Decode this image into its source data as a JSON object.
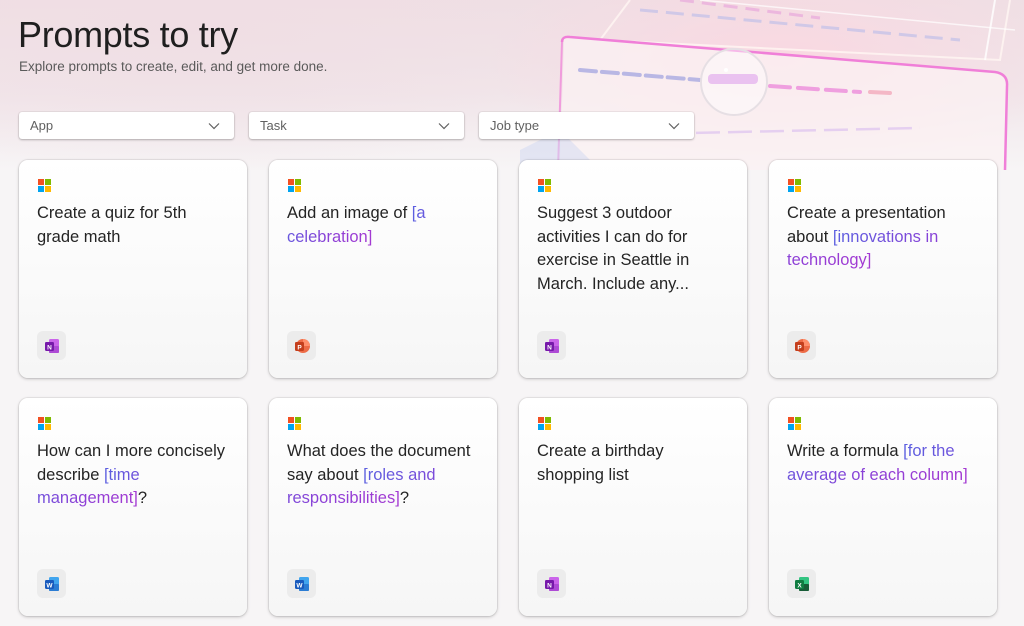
{
  "header": {
    "title": "Prompts to try",
    "subtitle": "Explore prompts to create, edit, and get more done."
  },
  "filters": [
    {
      "label": "App",
      "icon": "chevron-down-icon"
    },
    {
      "label": "Task",
      "icon": "chevron-down-icon"
    },
    {
      "label": "Job type",
      "icon": "chevron-down-icon"
    }
  ],
  "colors": {
    "highlight_start": "#5b5fe0",
    "highlight_end": "#a43ad2",
    "onenote": "#7719aa",
    "powerpoint": "#c43e1c",
    "word": "#185abd",
    "excel": "#107c41"
  },
  "cards": [
    {
      "text": "Create a quiz for 5th grade math",
      "highlight": "",
      "suffix": "",
      "app": "OneNote",
      "app_icon": "onenote-icon"
    },
    {
      "text": "Add an image of ",
      "highlight": "[a celebration]",
      "suffix": "",
      "app": "PowerPoint",
      "app_icon": "powerpoint-icon"
    },
    {
      "text": "Suggest 3 outdoor activities I can do for exercise in Seattle in March. Include any...",
      "highlight": "",
      "suffix": "",
      "app": "OneNote",
      "app_icon": "onenote-icon"
    },
    {
      "text": "Create a presentation about ",
      "highlight": "[innovations in technology]",
      "suffix": "",
      "app": "PowerPoint",
      "app_icon": "powerpoint-icon"
    },
    {
      "text": "How can I more concisely describe ",
      "highlight": "[time management]",
      "suffix": "?",
      "app": "Word",
      "app_icon": "word-icon"
    },
    {
      "text": "What does the document say about ",
      "highlight": "[roles and responsibilities]",
      "suffix": "?",
      "app": "Word",
      "app_icon": "word-icon"
    },
    {
      "text": "Create a birthday shopping list",
      "highlight": "",
      "suffix": "",
      "app": "OneNote",
      "app_icon": "onenote-icon"
    },
    {
      "text": "Write a formula ",
      "highlight": "[for the average of each column]",
      "suffix": "",
      "app": "Excel",
      "app_icon": "excel-icon"
    }
  ]
}
